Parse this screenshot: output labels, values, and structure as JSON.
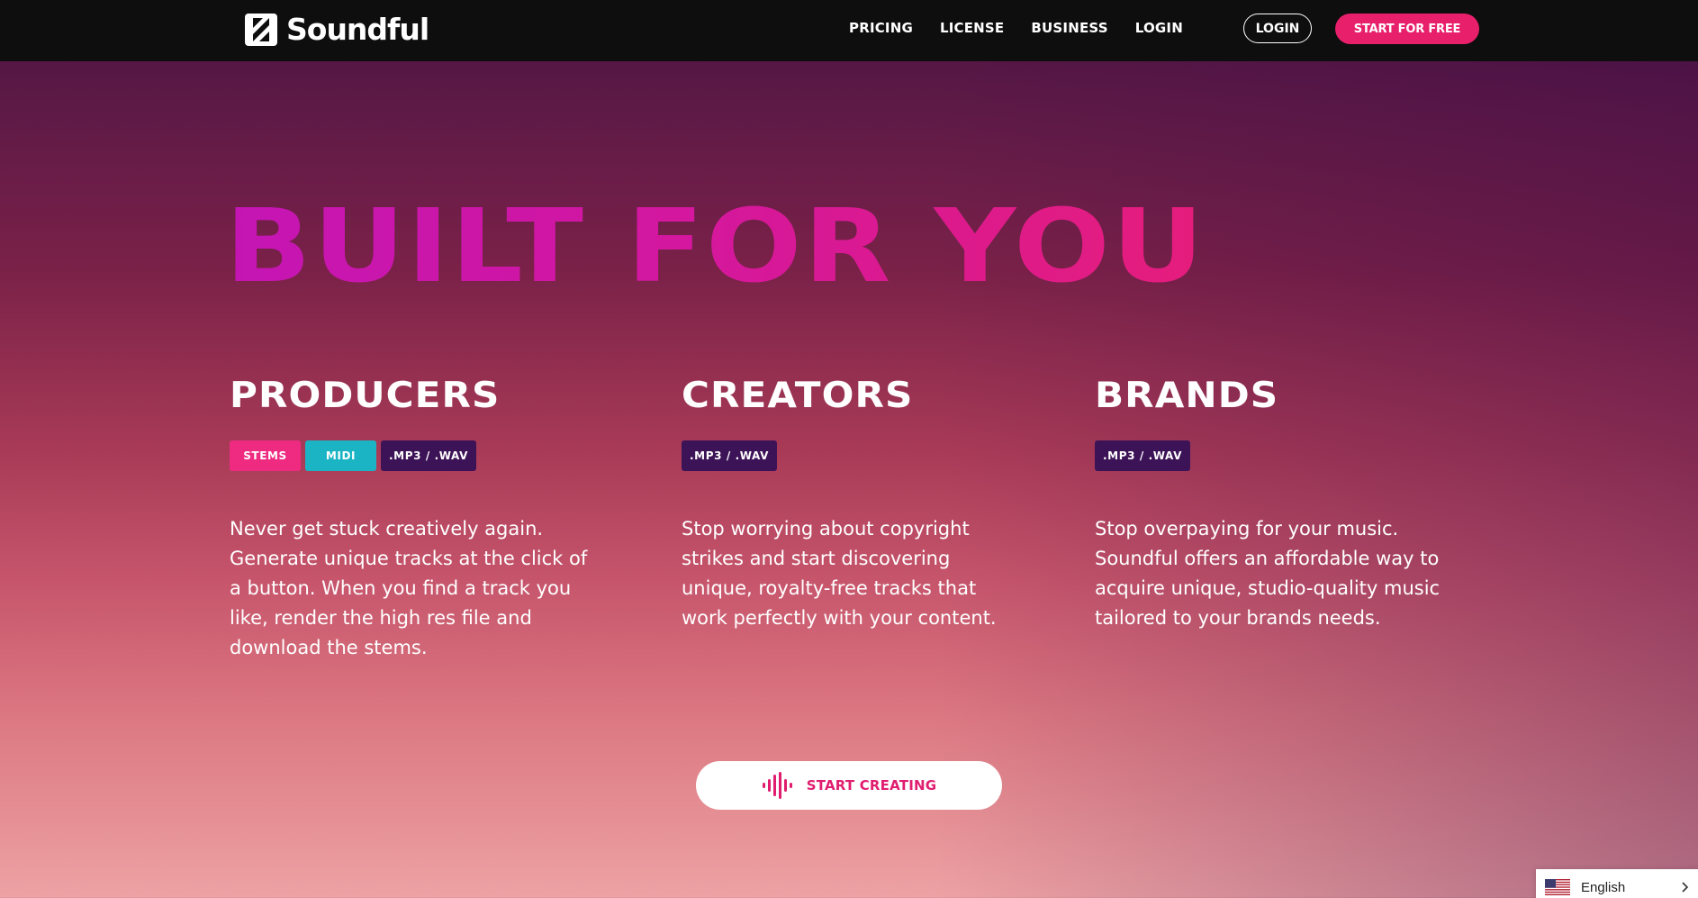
{
  "nav": {
    "logo_text": "Soundful",
    "links": [
      "PRICING",
      "LICENSE",
      "BUSINESS",
      "LOGIN"
    ],
    "login_button": "LOGIN",
    "start_button": "START FOR FREE"
  },
  "hero": {
    "title": "BUILT FOR YOU"
  },
  "columns": [
    {
      "heading": "PRODUCERS",
      "tags": [
        "STEMS",
        "MIDI",
        ".MP3 / .WAV"
      ],
      "description": "Never get stuck creatively again. Generate unique tracks at the click of a button. When you find a track you like, render the high res file and download the stems."
    },
    {
      "heading": "CREATORS",
      "tags": [
        ".MP3 / .WAV"
      ],
      "description": "Stop worrying about copyright strikes and start discovering unique, royalty-free tracks that work perfectly with your content."
    },
    {
      "heading": "BRANDS",
      "tags": [
        ".MP3 / .WAV"
      ],
      "description": "Stop overpaying for your music. Soundful offers an affordable way to acquire unique, studio-quality music tailored to your brands needs."
    }
  ],
  "cta": {
    "label": "START CREATING",
    "icon": "waveform-icon"
  },
  "language": {
    "selected": "English",
    "icon": "us-flag-icon"
  },
  "colors": {
    "accent": "#e81f6a",
    "teal": "#1bb4c4",
    "purple": "#3d1357",
    "nav_bg": "#0e0e0e"
  }
}
